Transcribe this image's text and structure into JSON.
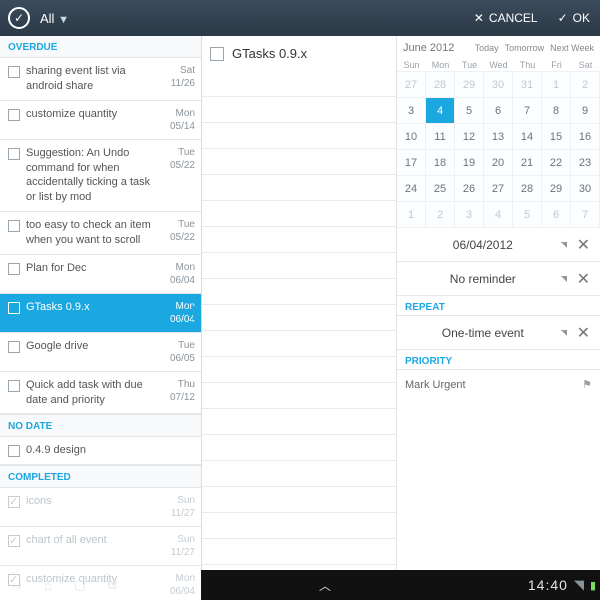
{
  "topbar": {
    "title": "All",
    "cancel": "CANCEL",
    "ok": "OK"
  },
  "sections": {
    "overdue": "OVERDUE",
    "nodate": "NO DATE",
    "completed": "COMPLETED"
  },
  "tasks": {
    "overdue": [
      {
        "title": "sharing event list via android share",
        "day": "Sat",
        "date": "11/26"
      },
      {
        "title": "customize quantity",
        "day": "Mon",
        "date": "05/14"
      },
      {
        "title": "Suggestion: An Undo command for when accidentally ticking a task or list by mod",
        "day": "Tue",
        "date": "05/22"
      },
      {
        "title": "too easy to check an item when you want to scroll",
        "day": "Tue",
        "date": "05/22"
      },
      {
        "title": "Plan for Dec",
        "day": "Mon",
        "date": "06/04"
      },
      {
        "title": "GTasks 0.9.x",
        "day": "Mon",
        "date": "06/04"
      },
      {
        "title": "Google drive",
        "day": "Tue",
        "date": "06/05"
      },
      {
        "title": "Quick add task with due date and priority",
        "day": "Thu",
        "date": "07/12"
      }
    ],
    "nodate": [
      {
        "title": "0.4.9 design",
        "day": "",
        "date": ""
      }
    ],
    "completed": [
      {
        "title": "icons",
        "day": "Sun",
        "date": "11/27"
      },
      {
        "title": "chart of all event",
        "day": "Sun",
        "date": "11/27"
      },
      {
        "title": "customize quantity",
        "day": "Mon",
        "date": "06/04"
      }
    ]
  },
  "detail": {
    "title": "GTasks 0.9.x"
  },
  "calendar": {
    "month": "June 2012",
    "ranges": {
      "today": "Today",
      "tomorrow": "Tomorrow",
      "nextweek": "Next Week"
    },
    "days": [
      "Sun",
      "Mon",
      "Tue",
      "Wed",
      "Thu",
      "Fri",
      "Sat"
    ],
    "cells": [
      [
        "27",
        "28",
        "29",
        "30",
        "31",
        "1",
        "2"
      ],
      [
        "3",
        "4",
        "5",
        "6",
        "7",
        "8",
        "9"
      ],
      [
        "10",
        "11",
        "12",
        "13",
        "14",
        "15",
        "16"
      ],
      [
        "17",
        "18",
        "19",
        "20",
        "21",
        "22",
        "23"
      ],
      [
        "24",
        "25",
        "26",
        "27",
        "28",
        "29",
        "30"
      ],
      [
        "1",
        "2",
        "3",
        "4",
        "5",
        "6",
        "7"
      ]
    ],
    "dimRows": [
      0,
      5
    ],
    "selected": {
      "row": 1,
      "col": 1
    }
  },
  "fields": {
    "date": "06/04/2012",
    "reminder": "No reminder",
    "repeatLabel": "REPEAT",
    "repeat": "One-time event",
    "priorityLabel": "PRIORITY",
    "priority": "Mark Urgent"
  },
  "navbar": {
    "time": "14:40"
  }
}
